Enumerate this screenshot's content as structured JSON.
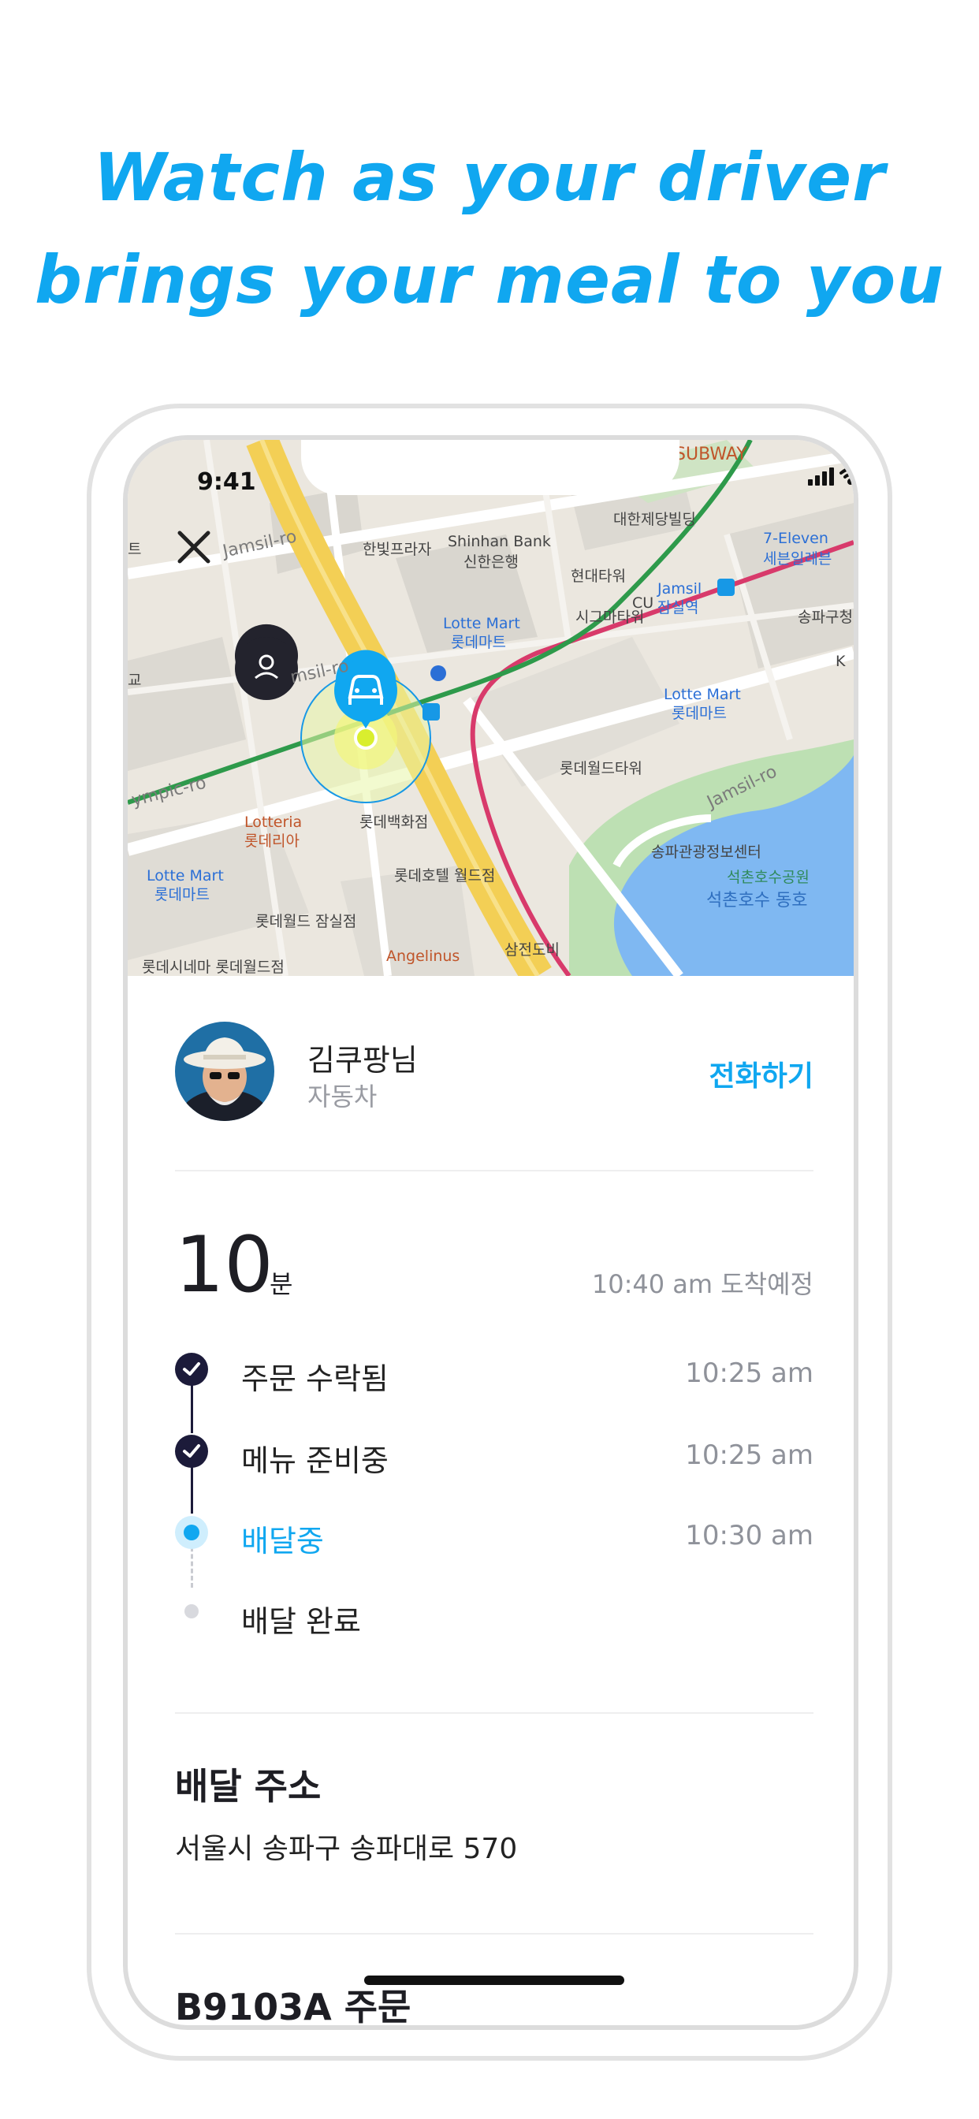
{
  "headline": {
    "line1": "Watch as your driver",
    "line2": "brings your meal to you"
  },
  "status_bar": {
    "time": "9:41"
  },
  "map": {
    "labels": {
      "subway": "SUBWAY",
      "daehan": "대한제당빌딩",
      "seven_eleven_en": "7-Eleven",
      "seven_eleven_ko": "세븐일레븐",
      "jamsil_ro_1": "Jamsil-ro",
      "hanbit": "한빛프라자",
      "shinhan_en": "Shinhan Bank",
      "shinhan_ko": "신한은행",
      "hyundai": "현대타워",
      "signa": "시그마타워",
      "jamsil_station_en": "Jamsil",
      "jamsil_station_ko": "잠실역",
      "songpa_gu": "송파구청",
      "teu": "트",
      "lotte_mart_1_en": "Lotte Mart",
      "lotte_mart_1_ko": "롯데마트",
      "jamsil_ro_2": "msil-ro",
      "lotte_mart_2_en": "Lotte Mart",
      "lotte_mart_2_ko": "롯데마트",
      "lotteworld_tower": "롯데월드타워",
      "olympic_ro": "ympic-ro",
      "lotteria_en": "Lotteria",
      "lotteria_ko": "롯데리아",
      "lotte_dept": "롯데백화점",
      "jamsil_ro_3": "Jamsil-ro",
      "songpa_office": "송파관광정보센터",
      "seokchon_park": "석촌호수공원",
      "seokchon_east": "석촌호수 동호",
      "lotte_mart_3_en": "Lotte Mart",
      "lotte_mart_3_ko": "롯데마트",
      "lotte_hotel": "롯데호텔 월드점",
      "lotteworld_jamsil": "롯데월드 잠실점",
      "angelinus": "Angelinus",
      "samjeon": "삼전도비",
      "lotte_cinema": "롯데시네마 롯데월드점",
      "gyo": "교",
      "k": "K",
      "cu": "CU"
    }
  },
  "driver": {
    "name": "김쿠팡님",
    "vehicle": "자동차",
    "call_label": "전화하기"
  },
  "eta": {
    "minutes": "10",
    "unit": "분",
    "arrival": "10:40 am 도착예정"
  },
  "steps": [
    {
      "label": "주문 수락됨",
      "time": "10:25 am",
      "state": "done"
    },
    {
      "label": "메뉴 준비중",
      "time": "10:25 am",
      "state": "done"
    },
    {
      "label": "배달중",
      "time": "10:30 am",
      "state": "active"
    },
    {
      "label": "배달 완료",
      "time": "",
      "state": "pending"
    }
  ],
  "address": {
    "title": "배달 주소",
    "value": "서울시 송파구 송파대로 570"
  },
  "order": {
    "title": "B9103A 주문"
  },
  "colors": {
    "accent": "#10a7f0",
    "dark": "#1c1b3a",
    "muted": "#8f929a"
  }
}
